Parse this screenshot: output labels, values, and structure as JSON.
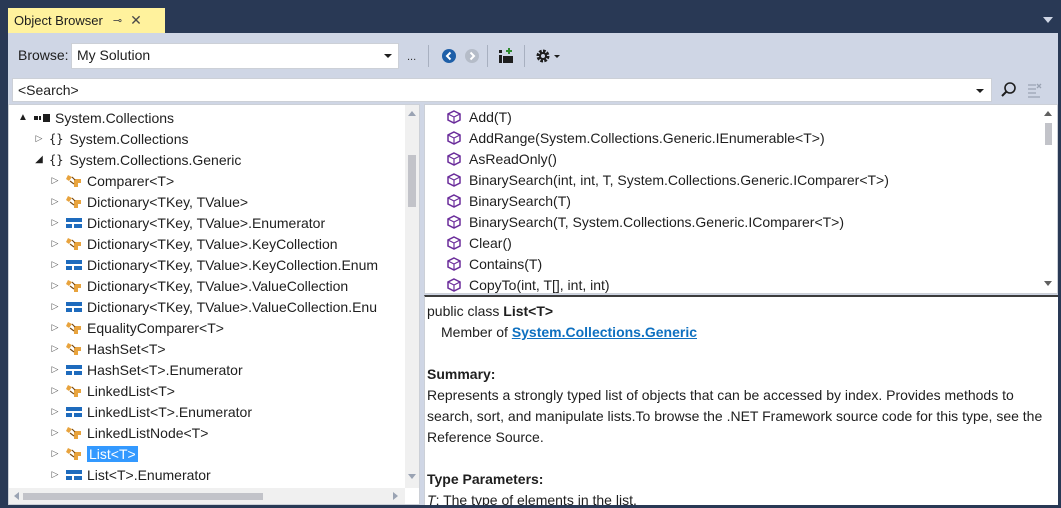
{
  "tab": {
    "title": "Object Browser",
    "pin": "⊸",
    "close": "✕"
  },
  "toolbar": {
    "browse_label": "Browse:",
    "browse_value": "My Solution",
    "ellipsis": "..."
  },
  "search": {
    "value": "<Search>"
  },
  "tree": [
    {
      "indent": 0,
      "expander": "▲",
      "icon": "assembly",
      "label": "System.Collections"
    },
    {
      "indent": 1,
      "expander": "▷",
      "icon": "namespace",
      "label": "System.Collections"
    },
    {
      "indent": 1,
      "expander": "◢",
      "icon": "namespace",
      "label": "System.Collections.Generic"
    },
    {
      "indent": 2,
      "expander": "▷",
      "icon": "class",
      "label": "Comparer<T>"
    },
    {
      "indent": 2,
      "expander": "▷",
      "icon": "class",
      "label": "Dictionary<TKey, TValue>"
    },
    {
      "indent": 2,
      "expander": "▷",
      "icon": "struct",
      "label": "Dictionary<TKey, TValue>.Enumerator"
    },
    {
      "indent": 2,
      "expander": "▷",
      "icon": "class",
      "label": "Dictionary<TKey, TValue>.KeyCollection"
    },
    {
      "indent": 2,
      "expander": "▷",
      "icon": "struct",
      "label": "Dictionary<TKey, TValue>.KeyCollection.Enum"
    },
    {
      "indent": 2,
      "expander": "▷",
      "icon": "class",
      "label": "Dictionary<TKey, TValue>.ValueCollection"
    },
    {
      "indent": 2,
      "expander": "▷",
      "icon": "struct",
      "label": "Dictionary<TKey, TValue>.ValueCollection.Enu"
    },
    {
      "indent": 2,
      "expander": "▷",
      "icon": "class",
      "label": "EqualityComparer<T>"
    },
    {
      "indent": 2,
      "expander": "▷",
      "icon": "class",
      "label": "HashSet<T>"
    },
    {
      "indent": 2,
      "expander": "▷",
      "icon": "struct",
      "label": "HashSet<T>.Enumerator"
    },
    {
      "indent": 2,
      "expander": "▷",
      "icon": "class",
      "label": "LinkedList<T>"
    },
    {
      "indent": 2,
      "expander": "▷",
      "icon": "struct",
      "label": "LinkedList<T>.Enumerator"
    },
    {
      "indent": 2,
      "expander": "▷",
      "icon": "class",
      "label": "LinkedListNode<T>"
    },
    {
      "indent": 2,
      "expander": "▷",
      "icon": "class",
      "label": "List<T>",
      "selected": true
    },
    {
      "indent": 2,
      "expander": "▷",
      "icon": "struct",
      "label": "List<T>.Enumerator"
    }
  ],
  "members": [
    "Add(T)",
    "AddRange(System.Collections.Generic.IEnumerable<T>)",
    "AsReadOnly()",
    "BinarySearch(int, int, T, System.Collections.Generic.IComparer<T>)",
    "BinarySearch(T)",
    "BinarySearch(T, System.Collections.Generic.IComparer<T>)",
    "Clear()",
    "Contains(T)",
    "CopyTo(int, T[], int, int)"
  ],
  "description": {
    "declaration_prefix": "public class ",
    "declaration_name": "List<T>",
    "member_of_prefix": "Member of ",
    "member_of_link": "System.Collections.Generic",
    "summary_heading": "Summary:",
    "summary_text": "Represents a strongly typed list of objects that can be accessed by index. Provides methods to search, sort, and manipulate lists.To browse the .NET Framework source code for this type, see the Reference Source.",
    "type_params_heading": "Type Parameters:",
    "type_param_name": "T",
    "type_param_text": ": The type of elements in the list."
  },
  "colors": {
    "frame": "#293955",
    "tab_active": "#fff29d",
    "chrome": "#cfd6e5",
    "selection": "#3399ff",
    "method_icon": "#6b2d9b",
    "class_icon": "#e8a33d",
    "struct_icon": "#1e6bbd",
    "link": "#0e70c0"
  }
}
